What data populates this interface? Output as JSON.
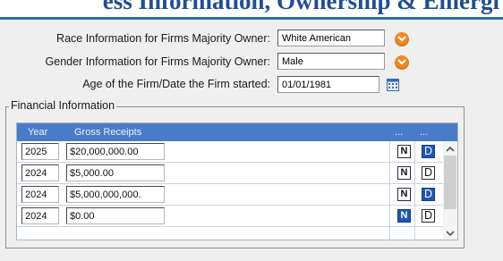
{
  "header": {
    "partial_title": "ess Information, Ownership & Emergi"
  },
  "form": {
    "race_label": "Race Information for Firms Majority Owner:",
    "race_value": "White American",
    "gender_label": "Gender Information for Firms Majority Owner:",
    "gender_value": "Male",
    "age_label": "Age of the Firm/Date the Firm started:",
    "age_value": "01/01/1981"
  },
  "financial": {
    "legend": "Financial Information",
    "columns": {
      "year": "Year",
      "gross": "Gross Receipts",
      "col3": "...",
      "col4": "..."
    },
    "rows": [
      {
        "year": "2025",
        "gross": "$20,000,000.00",
        "n": "N",
        "d": "D",
        "n_selected": false,
        "d_selected": true
      },
      {
        "year": "2024",
        "gross": "$5,000.00",
        "n": "N",
        "d": "D",
        "n_selected": false,
        "d_selected": false
      },
      {
        "year": "2024",
        "gross": "$5,000,000,000.",
        "n": "N",
        "d": "D",
        "n_selected": false,
        "d_selected": true
      },
      {
        "year": "2024",
        "gross": "$0.00",
        "n": "N",
        "d": "D",
        "n_selected": true,
        "d_selected": false
      }
    ]
  },
  "colors": {
    "header_blue": "#4a7bc9",
    "accent_orange": "#f08a24",
    "selected_blue": "#1f57b5",
    "title_blue": "#1f4f91"
  }
}
